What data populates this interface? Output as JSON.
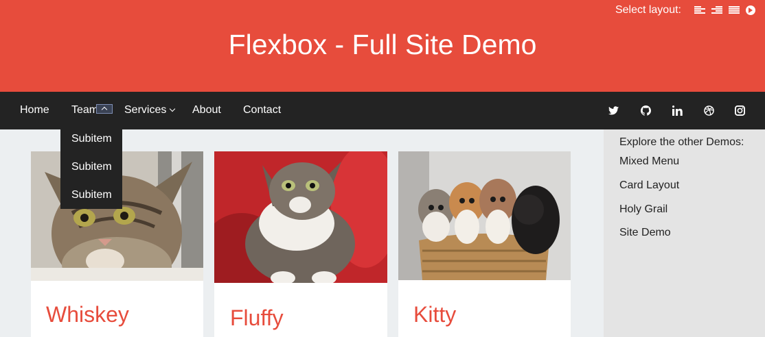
{
  "header": {
    "layout_label": "Select layout:",
    "layout_icons": [
      "align-left-icon",
      "align-right-icon",
      "align-justify-icon",
      "arrow-circle-right-icon"
    ],
    "title": "Flexbox - Full Site Demo",
    "accent_color": "#e74c3c"
  },
  "nav": {
    "items": [
      {
        "label": "Home"
      },
      {
        "label": "Team"
      },
      {
        "label": "Services"
      },
      {
        "label": "About"
      },
      {
        "label": "Contact"
      }
    ],
    "social_icons": [
      "twitter-icon",
      "github-icon",
      "linkedin-icon",
      "dribbble-icon",
      "instagram-icon"
    ]
  },
  "dropdown": {
    "items": [
      "Subitem",
      "Subitem",
      "Subitem"
    ]
  },
  "sidebar": {
    "intro": "Explore the other Demos:",
    "links": [
      "Mixed Menu",
      "Card Layout",
      "Holy Grail",
      "Site Demo"
    ]
  },
  "cards": [
    {
      "name": "Whiskey"
    },
    {
      "name": "Fluffy"
    },
    {
      "name": "Kitty"
    }
  ]
}
